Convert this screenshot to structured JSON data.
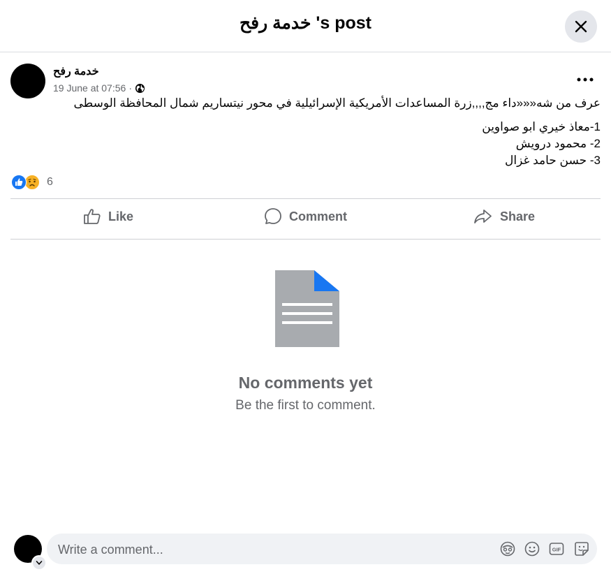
{
  "dialog": {
    "title": "خدمة رفح 's post"
  },
  "post": {
    "author": "خدمة رفح",
    "timestamp": "19 June at 07:56",
    "separator": "·",
    "privacy_icon": "globe-icon",
    "text_line1": "عرف من شه«««داء مج,,,,زرة المساعدات الأمريكية الإسرائيلية في محور نيتساريم شمال المحافظة الوسطى",
    "list": [
      "1-معاذ خيري ابو صواوين",
      "2- محمود درويش",
      "3- حسن حامد غزال"
    ]
  },
  "reactions": {
    "icons": [
      "like-reaction-icon",
      "sad-reaction-icon"
    ],
    "count": "6"
  },
  "actions": {
    "like": "Like",
    "comment": "Comment",
    "share": "Share"
  },
  "empty_state": {
    "title": "No comments yet",
    "subtitle": "Be the first to comment."
  },
  "composer": {
    "placeholder": "Write a comment...",
    "tools": [
      "avatar-sticker-icon",
      "emoji-icon",
      "gif-icon",
      "sticker-icon"
    ]
  },
  "colors": {
    "accent": "#1877f2",
    "text": "#050505",
    "secondary": "#65676b",
    "divider": "#ced0d4",
    "input_bg": "#f0f2f5"
  }
}
